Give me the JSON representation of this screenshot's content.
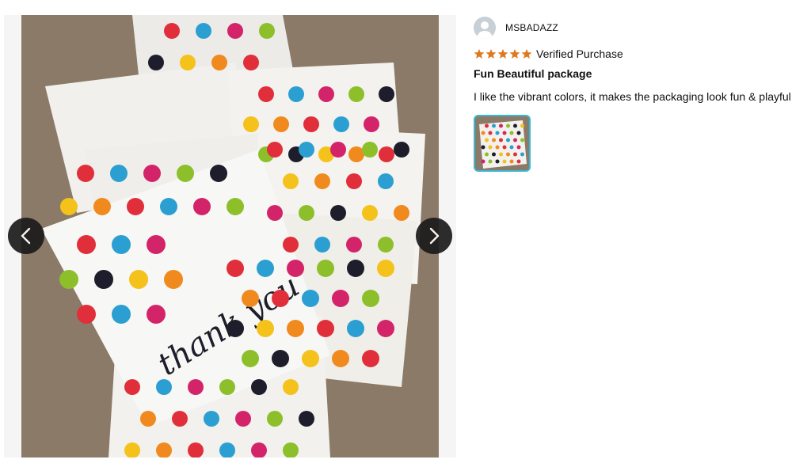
{
  "photo": {
    "alt_text_none": "",
    "overlay_text": "thank you",
    "colors": {
      "carpet": "#8c7a68",
      "bag": "#f2f2f0",
      "dots": [
        "#e02f3a",
        "#f4c21a",
        "#8dbf2a",
        "#2b9fd1",
        "#f08a1e",
        "#1d1d2b",
        "#d3246a"
      ]
    }
  },
  "navigation": {
    "prev_icon": "chevron-left-icon",
    "next_icon": "chevron-right-icon"
  },
  "review": {
    "reviewer_name": "MSBADAZZ",
    "avatar_icon": "user-avatar-icon",
    "rating": 5,
    "rating_max": 5,
    "star_color": "#de7921",
    "verified_label": "Verified Purchase",
    "title": "Fun Beautiful package",
    "body": "I like the vibrant colors, it makes the packaging look fun & playful",
    "thumbnail_border_color": "#38b8d6"
  }
}
